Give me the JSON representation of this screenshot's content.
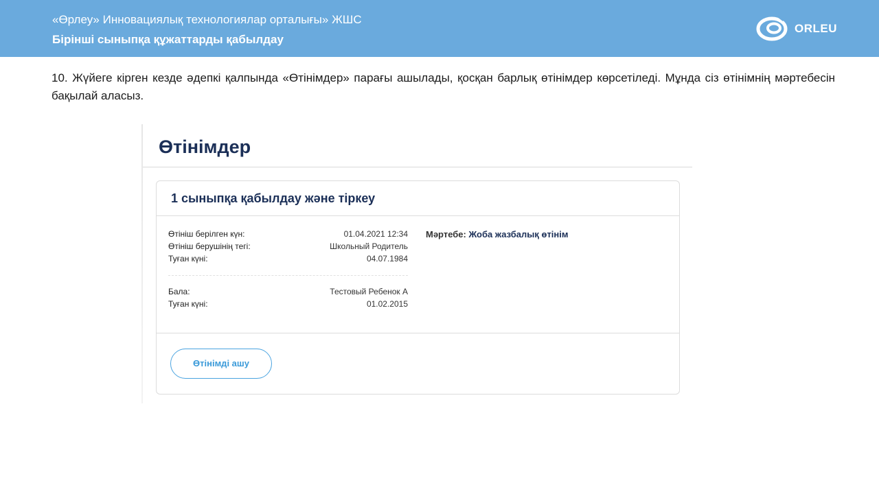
{
  "header": {
    "org_name": "«Өрлеу» Инновациялық технологиялар орталығы» ЖШС",
    "section_title": "Бірінші сыныпқа құжаттарды қабылдау",
    "logo_text": "ORLEU",
    "background_color": "#6aaadd"
  },
  "instruction": {
    "text": "10. Жүйеге кірген кезде әдепкі қалпында «Өтінімдер» парағы ашылады, қосқан барлық өтінімдер көрсетіледі. Мұнда сіз өтінімнің мәртебесін бақылай аласыз."
  },
  "app": {
    "page_title": "Өтінімдер",
    "card": {
      "title": "1 сыныпқа қабылдау және тіркеу",
      "applicant_rows": [
        {
          "label": "Өтініш берілген күн:",
          "value": "01.04.2021 12:34"
        },
        {
          "label": "Өтініш берушінің тегі:",
          "value": "Школьный Родитель"
        },
        {
          "label": "Туған күні:",
          "value": "04.07.1984"
        }
      ],
      "child_rows": [
        {
          "label": "Бала:",
          "value": "Тестовый Ребенок А"
        },
        {
          "label": "Туған күні:",
          "value": "01.02.2015"
        }
      ],
      "status_label": "Мәртебе:",
      "status_value": "Жоба жазбалық өтінім",
      "open_button_label": "Өтінімді ашу"
    },
    "accent_color": "#1b2f57",
    "button_color": "#49a3e0"
  }
}
